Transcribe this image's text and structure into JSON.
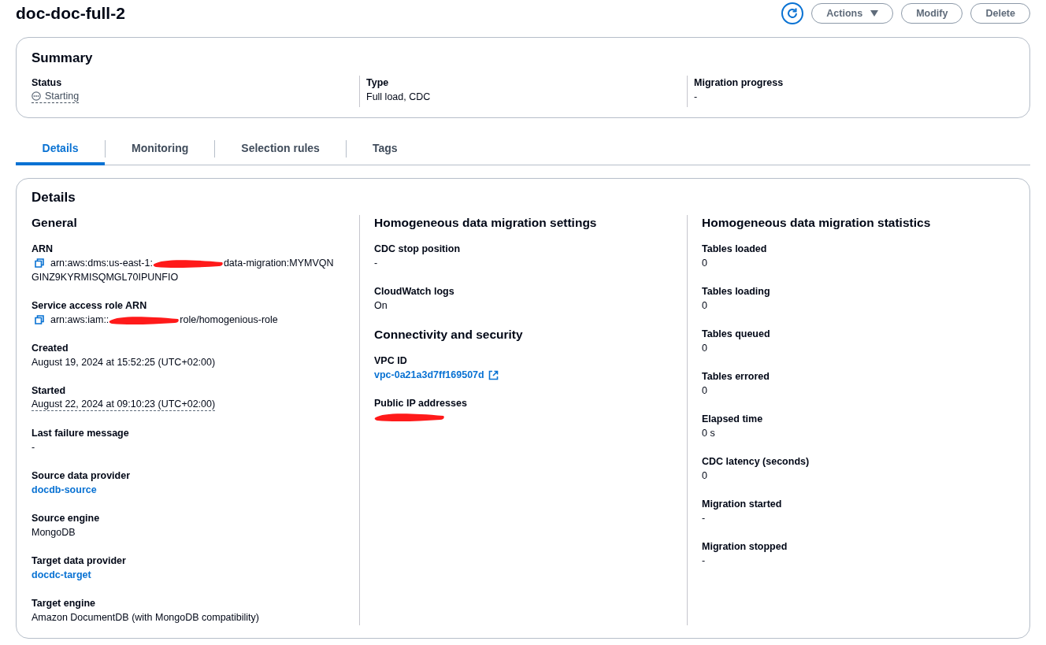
{
  "header": {
    "title": "doc-doc-full-2",
    "buttons": [
      {
        "kind": "refresh"
      },
      {
        "kind": "dropdown",
        "label": "Actions"
      },
      {
        "kind": "plain",
        "label": "Modify"
      },
      {
        "kind": "plain",
        "label": "Delete"
      }
    ]
  },
  "summary": {
    "title": "Summary",
    "items": [
      {
        "label": "Status",
        "kind": "status",
        "value": "Starting"
      },
      {
        "label": "Type",
        "kind": "text",
        "value": "Full load, CDC"
      },
      {
        "label": "Migration progress",
        "kind": "text",
        "value": "-"
      }
    ]
  },
  "tabs": [
    {
      "label": "Details",
      "selected": true
    },
    {
      "label": "Monitoring",
      "selected": false
    },
    {
      "label": "Selection rules",
      "selected": false
    },
    {
      "label": "Tags",
      "selected": false
    }
  ],
  "details": {
    "title": "Details",
    "columns": [
      [
        {
          "heading": "General",
          "fields": [
            {
              "label": "ARN",
              "kind": "copy",
              "segments": [
                {
                  "kind": "text",
                  "text": "arn:aws:dms:us-east-1:"
                },
                {
                  "kind": "redacted"
                },
                {
                  "kind": "text",
                  "text": "data-migration:MYMVQN"
                },
                {
                  "kind": "line",
                  "text": "GINZ9KYRMISQMGL70IPUNFIO"
                }
              ]
            },
            {
              "label": "Service access role ARN",
              "kind": "copy",
              "segments": [
                {
                  "kind": "text",
                  "text": "arn:aws:iam::"
                },
                {
                  "kind": "redacted"
                },
                {
                  "kind": "text",
                  "text": "role/homogenious-role"
                }
              ]
            },
            {
              "label": "Created",
              "kind": "text",
              "value": "August 19, 2024 at 15:52:25 (UTC+02:00)"
            },
            {
              "label": "Started",
              "kind": "dotted",
              "value": "August 22, 2024 at 09:10:23 (UTC+02:00)"
            },
            {
              "label": "Last failure message",
              "kind": "text",
              "value": "-"
            },
            {
              "label": "Source data provider",
              "kind": "link",
              "value": "docdb-source"
            },
            {
              "label": "Source engine",
              "kind": "text",
              "value": "MongoDB"
            },
            {
              "label": "Target data provider",
              "kind": "link",
              "value": "docdc-target"
            },
            {
              "label": "Target engine",
              "kind": "text",
              "value": "Amazon DocumentDB (with MongoDB compatibility)"
            }
          ]
        }
      ],
      [
        {
          "heading": "Homogeneous data migration settings",
          "fields": [
            {
              "label": "CDC stop position",
              "kind": "text",
              "value": "-"
            },
            {
              "label": "CloudWatch logs",
              "kind": "text",
              "value": "On"
            }
          ]
        },
        {
          "heading": "Connectivity and security",
          "fields": [
            {
              "label": "VPC ID",
              "kind": "external",
              "value": "vpc-0a21a3d7ff169507d"
            },
            {
              "label": "Public IP addresses",
              "kind": "redacted-value"
            }
          ]
        }
      ],
      [
        {
          "heading": "Homogeneous data migration statistics",
          "fields": [
            {
              "label": "Tables loaded",
              "kind": "text",
              "value": "0"
            },
            {
              "label": "Tables loading",
              "kind": "text",
              "value": "0"
            },
            {
              "label": "Tables queued",
              "kind": "text",
              "value": "0"
            },
            {
              "label": "Tables errored",
              "kind": "text",
              "value": "0"
            },
            {
              "label": "Elapsed time",
              "kind": "text",
              "value": "0 s"
            },
            {
              "label": "CDC latency (seconds)",
              "kind": "text",
              "value": "0"
            },
            {
              "label": "Migration started",
              "kind": "text",
              "value": "-"
            },
            {
              "label": "Migration stopped",
              "kind": "text",
              "value": "-"
            }
          ]
        }
      ]
    ]
  }
}
